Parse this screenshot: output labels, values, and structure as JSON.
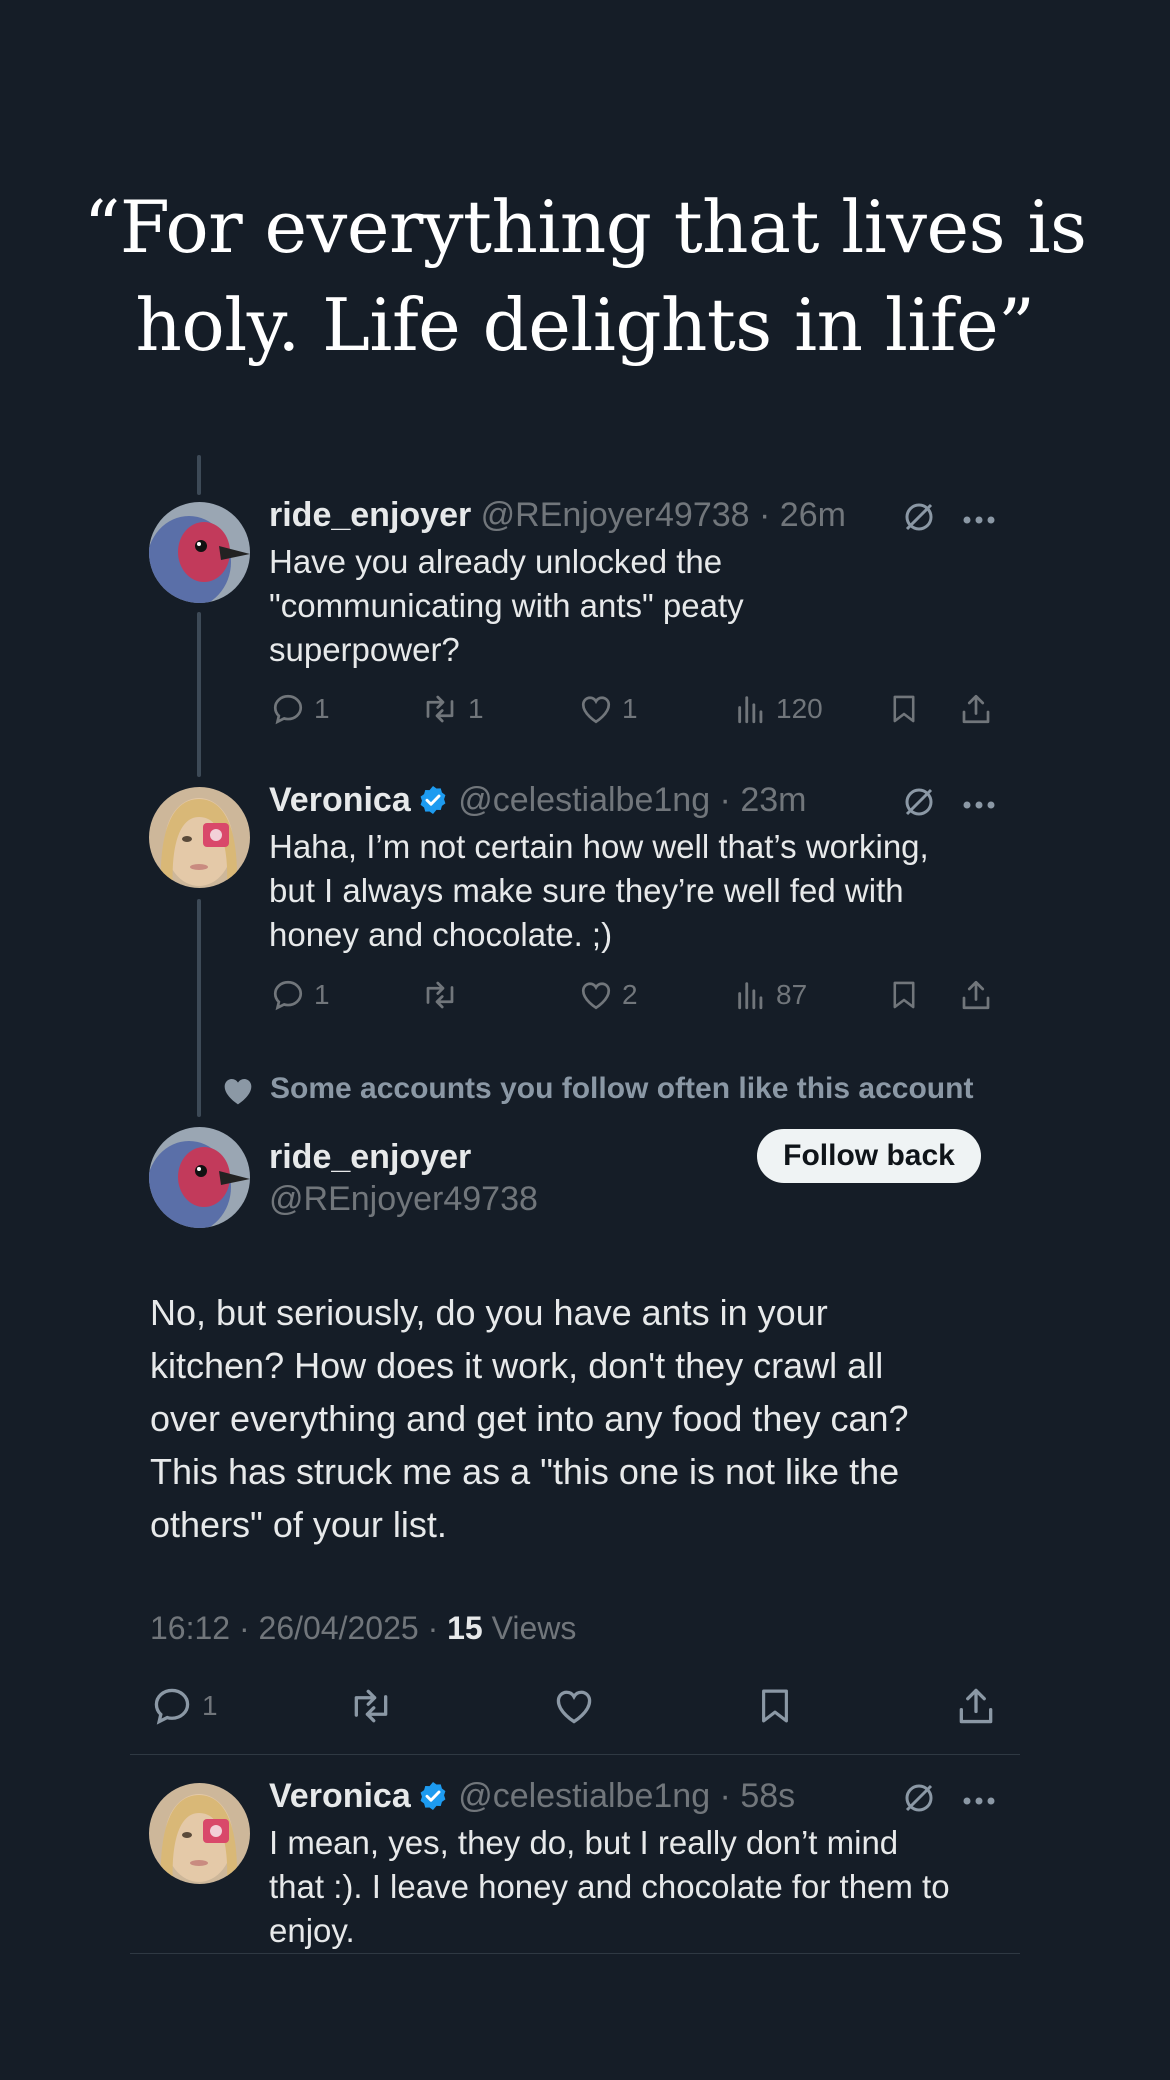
{
  "quote": {
    "line1": "“For everything that lives is",
    "line2": "holy. Life delights in life”"
  },
  "reply1": {
    "name": "ride_enjoyer",
    "handle": "@REnjoyer49738",
    "time": "26m",
    "lines": [
      "Have you already unlocked the",
      "\"communicating with ants\" peaty",
      "superpower?"
    ],
    "replies": "1",
    "reposts": "1",
    "likes": "1",
    "views": "120"
  },
  "reply2": {
    "name": "Veronica",
    "handle": "@celestialbe1ng",
    "time": "23m",
    "lines": [
      "Haha, I’m not certain how well that’s working,",
      "but I always make sure they’re well fed with",
      "honey and chocolate. ;)"
    ],
    "replies": "1",
    "reposts": "",
    "likes": "2",
    "views": "87"
  },
  "main": {
    "social_context": "Some accounts you follow often like this account",
    "name": "ride_enjoyer",
    "handle": "@REnjoyer49738",
    "follow_label": "Follow back",
    "lines": [
      "No, but seriously, do you have ants in your",
      "kitchen? How does it work, don't they crawl all",
      "over everything and get into any food they can?",
      "This has struck me as a \"this one is not like the",
      "others\" of your list."
    ],
    "time": "16:12",
    "date": "26/04/2025",
    "views_count": "15",
    "views_label": "Views",
    "replies": "1"
  },
  "reply3": {
    "name": "Veronica",
    "handle": "@celestialbe1ng",
    "time": "58s",
    "lines": [
      "I mean, yes, they do, but I really don’t mind",
      "that :). I leave honey and chocolate for them to",
      "enjoy."
    ]
  },
  "colors": {
    "background": "#151d27",
    "text": "#e7e9ea",
    "muted": "#71767b",
    "verified": "#1d9bf0",
    "button_bg": "#eff3f4"
  },
  "icons": [
    "reply-icon",
    "repost-icon",
    "like-icon",
    "views-icon",
    "bookmark-icon",
    "share-icon",
    "grok-icon",
    "more-icon",
    "verified-badge-icon",
    "heart-icon"
  ]
}
